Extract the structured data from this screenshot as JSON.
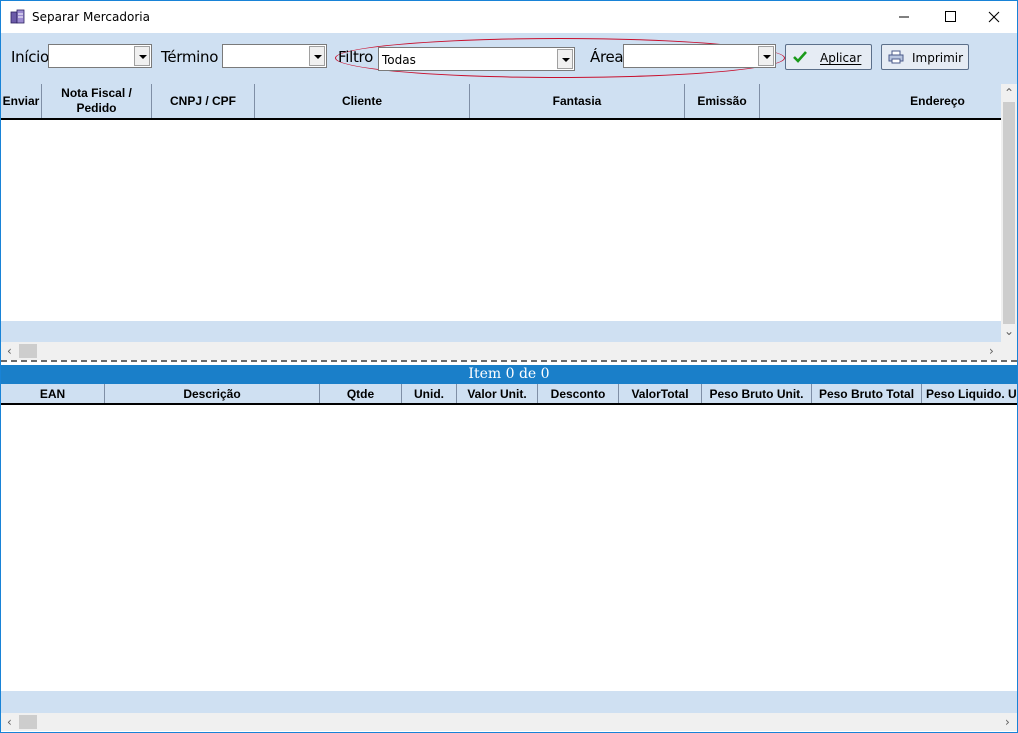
{
  "window": {
    "title": "Separar Mercadoria",
    "minimize_glyph": "—",
    "maximize_glyph": "☐",
    "close_glyph": "✕"
  },
  "toolbar": {
    "inicio_label": "Início",
    "inicio_value": "",
    "termino_label": "Término",
    "termino_value": "",
    "filtro_label": "Filtro",
    "filtro_value": "Todas",
    "area_label": "Área",
    "area_value": "",
    "aplicar_label": "Aplicar",
    "imprimir_label": "Imprimir",
    "accent_ring_color": "#c8102e"
  },
  "grid_top": {
    "columns": [
      {
        "label": "Enviar"
      },
      {
        "label": "Nota Fiscal / Pedido"
      },
      {
        "label": "CNPJ / CPF"
      },
      {
        "label": "Cliente"
      },
      {
        "label": "Fantasia"
      },
      {
        "label": "Emissão"
      },
      {
        "label": "Endereço"
      }
    ]
  },
  "item_bar": {
    "text": "Item 0 de 0"
  },
  "grid_bottom": {
    "columns": [
      {
        "label": "EAN"
      },
      {
        "label": "Descrição"
      },
      {
        "label": "Qtde"
      },
      {
        "label": "Unid."
      },
      {
        "label": "Valor Unit."
      },
      {
        "label": "Desconto"
      },
      {
        "label": "ValorTotal"
      },
      {
        "label": "Peso Bruto Unit."
      },
      {
        "label": "Peso Bruto Total"
      },
      {
        "label": "Peso Liquido. Un"
      }
    ]
  },
  "colors": {
    "header_bg": "#cfe0f2",
    "item_bar_bg": "#1a7fc9",
    "window_border": "#1883d7"
  }
}
